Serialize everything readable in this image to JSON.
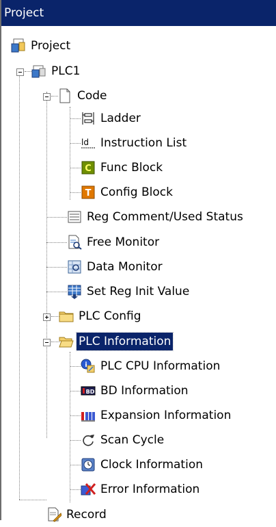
{
  "panel": {
    "title": "Project"
  },
  "tree": {
    "root": {
      "label": "Project",
      "icon": "project-icon"
    },
    "plc": {
      "label": "PLC1",
      "icon": "plc-icon",
      "expanded": true
    },
    "code": {
      "label": "Code",
      "icon": "document-icon",
      "expanded": true
    },
    "code_items": [
      {
        "label": "Ladder",
        "icon": "ladder-icon"
      },
      {
        "label": "Instruction List",
        "icon": "instruction-list-icon"
      },
      {
        "label": "Func Block",
        "icon": "func-block-icon",
        "badge": "C"
      },
      {
        "label": "Config Block",
        "icon": "config-block-icon",
        "badge": "T"
      }
    ],
    "plc_items": [
      {
        "label": "Reg Comment/Used Status",
        "icon": "reg-comment-icon"
      },
      {
        "label": "Free Monitor",
        "icon": "free-monitor-icon"
      },
      {
        "label": "Data Monitor",
        "icon": "data-monitor-icon"
      },
      {
        "label": "Set Reg Init Value",
        "icon": "set-reg-init-icon"
      }
    ],
    "plc_config": {
      "label": "PLC Config",
      "icon": "folder-icon",
      "expanded": false
    },
    "plc_information": {
      "label": "PLC Information",
      "icon": "folder-open-icon",
      "expanded": true,
      "selected": true
    },
    "info_items": [
      {
        "label": "PLC CPU Information",
        "icon": "cpu-info-icon"
      },
      {
        "label": "BD Information",
        "icon": "bd-info-icon"
      },
      {
        "label": "Expansion Information",
        "icon": "expansion-info-icon"
      },
      {
        "label": "Scan Cycle",
        "icon": "scan-cycle-icon"
      },
      {
        "label": "Clock Information",
        "icon": "clock-icon"
      },
      {
        "label": "Error Information",
        "icon": "error-info-icon"
      }
    ],
    "record": {
      "label": "Record",
      "icon": "record-icon"
    }
  }
}
